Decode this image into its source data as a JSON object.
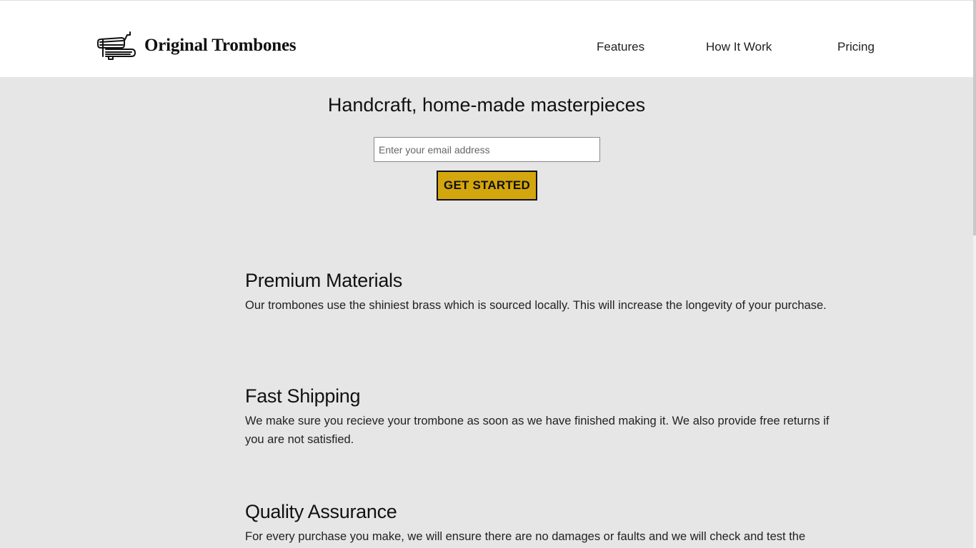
{
  "header": {
    "logo_icon": "trombone-icon",
    "brand": "Original Trombones",
    "nav": [
      {
        "label": "Features"
      },
      {
        "label": "How It Work"
      },
      {
        "label": "Pricing"
      }
    ]
  },
  "hero": {
    "title": "Handcraft, home-made masterpieces",
    "email_placeholder": "Enter your email address",
    "email_value": "",
    "cta_label": "GET STARTED"
  },
  "features": [
    {
      "title": "Premium Materials",
      "text": "Our trombones use the shiniest brass which is sourced locally. This will increase the longevity of your purchase."
    },
    {
      "title": "Fast Shipping",
      "text": "We make sure you recieve your trombone as soon as we have finished making it. We also provide free returns if you are not satisfied."
    },
    {
      "title": "Quality Assurance",
      "text": "For every purchase you make, we will ensure there are no damages or faults and we will check and test the"
    }
  ],
  "colors": {
    "page_background": "#e6e6e6",
    "header_background": "#ffffff",
    "cta_background": "#d4a60e"
  }
}
